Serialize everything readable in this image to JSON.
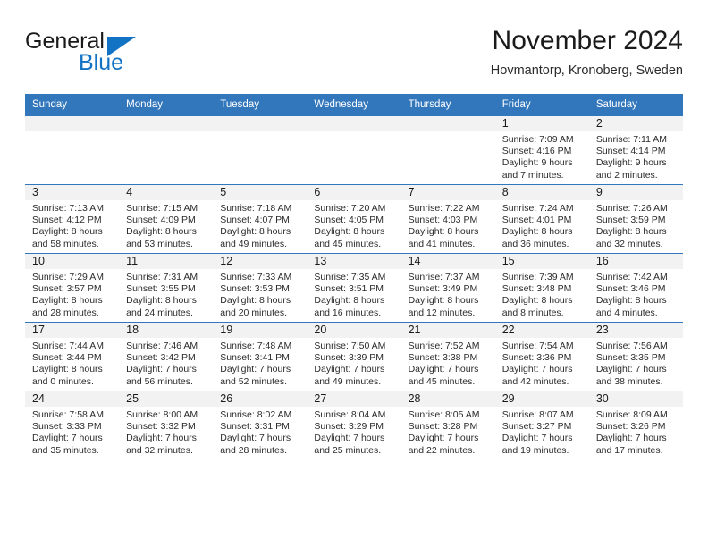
{
  "logo": {
    "word_black": "General",
    "word_blue": "Blue",
    "accent_color": "#1272c4"
  },
  "header": {
    "title": "November 2024",
    "location": "Hovmantorp, Kronoberg, Sweden"
  },
  "calendar": {
    "header_background": "#3277bc",
    "date_band_background": "#f2f2f2",
    "weekday_headers": [
      "Sunday",
      "Monday",
      "Tuesday",
      "Wednesday",
      "Thursday",
      "Friday",
      "Saturday"
    ],
    "weeks": [
      [
        {
          "date": "",
          "lines": []
        },
        {
          "date": "",
          "lines": []
        },
        {
          "date": "",
          "lines": []
        },
        {
          "date": "",
          "lines": []
        },
        {
          "date": "",
          "lines": []
        },
        {
          "date": "1",
          "lines": [
            "Sunrise: 7:09 AM",
            "Sunset: 4:16 PM",
            "Daylight: 9 hours",
            "and 7 minutes."
          ]
        },
        {
          "date": "2",
          "lines": [
            "Sunrise: 7:11 AM",
            "Sunset: 4:14 PM",
            "Daylight: 9 hours",
            "and 2 minutes."
          ]
        }
      ],
      [
        {
          "date": "3",
          "lines": [
            "Sunrise: 7:13 AM",
            "Sunset: 4:12 PM",
            "Daylight: 8 hours",
            "and 58 minutes."
          ]
        },
        {
          "date": "4",
          "lines": [
            "Sunrise: 7:15 AM",
            "Sunset: 4:09 PM",
            "Daylight: 8 hours",
            "and 53 minutes."
          ]
        },
        {
          "date": "5",
          "lines": [
            "Sunrise: 7:18 AM",
            "Sunset: 4:07 PM",
            "Daylight: 8 hours",
            "and 49 minutes."
          ]
        },
        {
          "date": "6",
          "lines": [
            "Sunrise: 7:20 AM",
            "Sunset: 4:05 PM",
            "Daylight: 8 hours",
            "and 45 minutes."
          ]
        },
        {
          "date": "7",
          "lines": [
            "Sunrise: 7:22 AM",
            "Sunset: 4:03 PM",
            "Daylight: 8 hours",
            "and 41 minutes."
          ]
        },
        {
          "date": "8",
          "lines": [
            "Sunrise: 7:24 AM",
            "Sunset: 4:01 PM",
            "Daylight: 8 hours",
            "and 36 minutes."
          ]
        },
        {
          "date": "9",
          "lines": [
            "Sunrise: 7:26 AM",
            "Sunset: 3:59 PM",
            "Daylight: 8 hours",
            "and 32 minutes."
          ]
        }
      ],
      [
        {
          "date": "10",
          "lines": [
            "Sunrise: 7:29 AM",
            "Sunset: 3:57 PM",
            "Daylight: 8 hours",
            "and 28 minutes."
          ]
        },
        {
          "date": "11",
          "lines": [
            "Sunrise: 7:31 AM",
            "Sunset: 3:55 PM",
            "Daylight: 8 hours",
            "and 24 minutes."
          ]
        },
        {
          "date": "12",
          "lines": [
            "Sunrise: 7:33 AM",
            "Sunset: 3:53 PM",
            "Daylight: 8 hours",
            "and 20 minutes."
          ]
        },
        {
          "date": "13",
          "lines": [
            "Sunrise: 7:35 AM",
            "Sunset: 3:51 PM",
            "Daylight: 8 hours",
            "and 16 minutes."
          ]
        },
        {
          "date": "14",
          "lines": [
            "Sunrise: 7:37 AM",
            "Sunset: 3:49 PM",
            "Daylight: 8 hours",
            "and 12 minutes."
          ]
        },
        {
          "date": "15",
          "lines": [
            "Sunrise: 7:39 AM",
            "Sunset: 3:48 PM",
            "Daylight: 8 hours",
            "and 8 minutes."
          ]
        },
        {
          "date": "16",
          "lines": [
            "Sunrise: 7:42 AM",
            "Sunset: 3:46 PM",
            "Daylight: 8 hours",
            "and 4 minutes."
          ]
        }
      ],
      [
        {
          "date": "17",
          "lines": [
            "Sunrise: 7:44 AM",
            "Sunset: 3:44 PM",
            "Daylight: 8 hours",
            "and 0 minutes."
          ]
        },
        {
          "date": "18",
          "lines": [
            "Sunrise: 7:46 AM",
            "Sunset: 3:42 PM",
            "Daylight: 7 hours",
            "and 56 minutes."
          ]
        },
        {
          "date": "19",
          "lines": [
            "Sunrise: 7:48 AM",
            "Sunset: 3:41 PM",
            "Daylight: 7 hours",
            "and 52 minutes."
          ]
        },
        {
          "date": "20",
          "lines": [
            "Sunrise: 7:50 AM",
            "Sunset: 3:39 PM",
            "Daylight: 7 hours",
            "and 49 minutes."
          ]
        },
        {
          "date": "21",
          "lines": [
            "Sunrise: 7:52 AM",
            "Sunset: 3:38 PM",
            "Daylight: 7 hours",
            "and 45 minutes."
          ]
        },
        {
          "date": "22",
          "lines": [
            "Sunrise: 7:54 AM",
            "Sunset: 3:36 PM",
            "Daylight: 7 hours",
            "and 42 minutes."
          ]
        },
        {
          "date": "23",
          "lines": [
            "Sunrise: 7:56 AM",
            "Sunset: 3:35 PM",
            "Daylight: 7 hours",
            "and 38 minutes."
          ]
        }
      ],
      [
        {
          "date": "24",
          "lines": [
            "Sunrise: 7:58 AM",
            "Sunset: 3:33 PM",
            "Daylight: 7 hours",
            "and 35 minutes."
          ]
        },
        {
          "date": "25",
          "lines": [
            "Sunrise: 8:00 AM",
            "Sunset: 3:32 PM",
            "Daylight: 7 hours",
            "and 32 minutes."
          ]
        },
        {
          "date": "26",
          "lines": [
            "Sunrise: 8:02 AM",
            "Sunset: 3:31 PM",
            "Daylight: 7 hours",
            "and 28 minutes."
          ]
        },
        {
          "date": "27",
          "lines": [
            "Sunrise: 8:04 AM",
            "Sunset: 3:29 PM",
            "Daylight: 7 hours",
            "and 25 minutes."
          ]
        },
        {
          "date": "28",
          "lines": [
            "Sunrise: 8:05 AM",
            "Sunset: 3:28 PM",
            "Daylight: 7 hours",
            "and 22 minutes."
          ]
        },
        {
          "date": "29",
          "lines": [
            "Sunrise: 8:07 AM",
            "Sunset: 3:27 PM",
            "Daylight: 7 hours",
            "and 19 minutes."
          ]
        },
        {
          "date": "30",
          "lines": [
            "Sunrise: 8:09 AM",
            "Sunset: 3:26 PM",
            "Daylight: 7 hours",
            "and 17 minutes."
          ]
        }
      ]
    ]
  }
}
